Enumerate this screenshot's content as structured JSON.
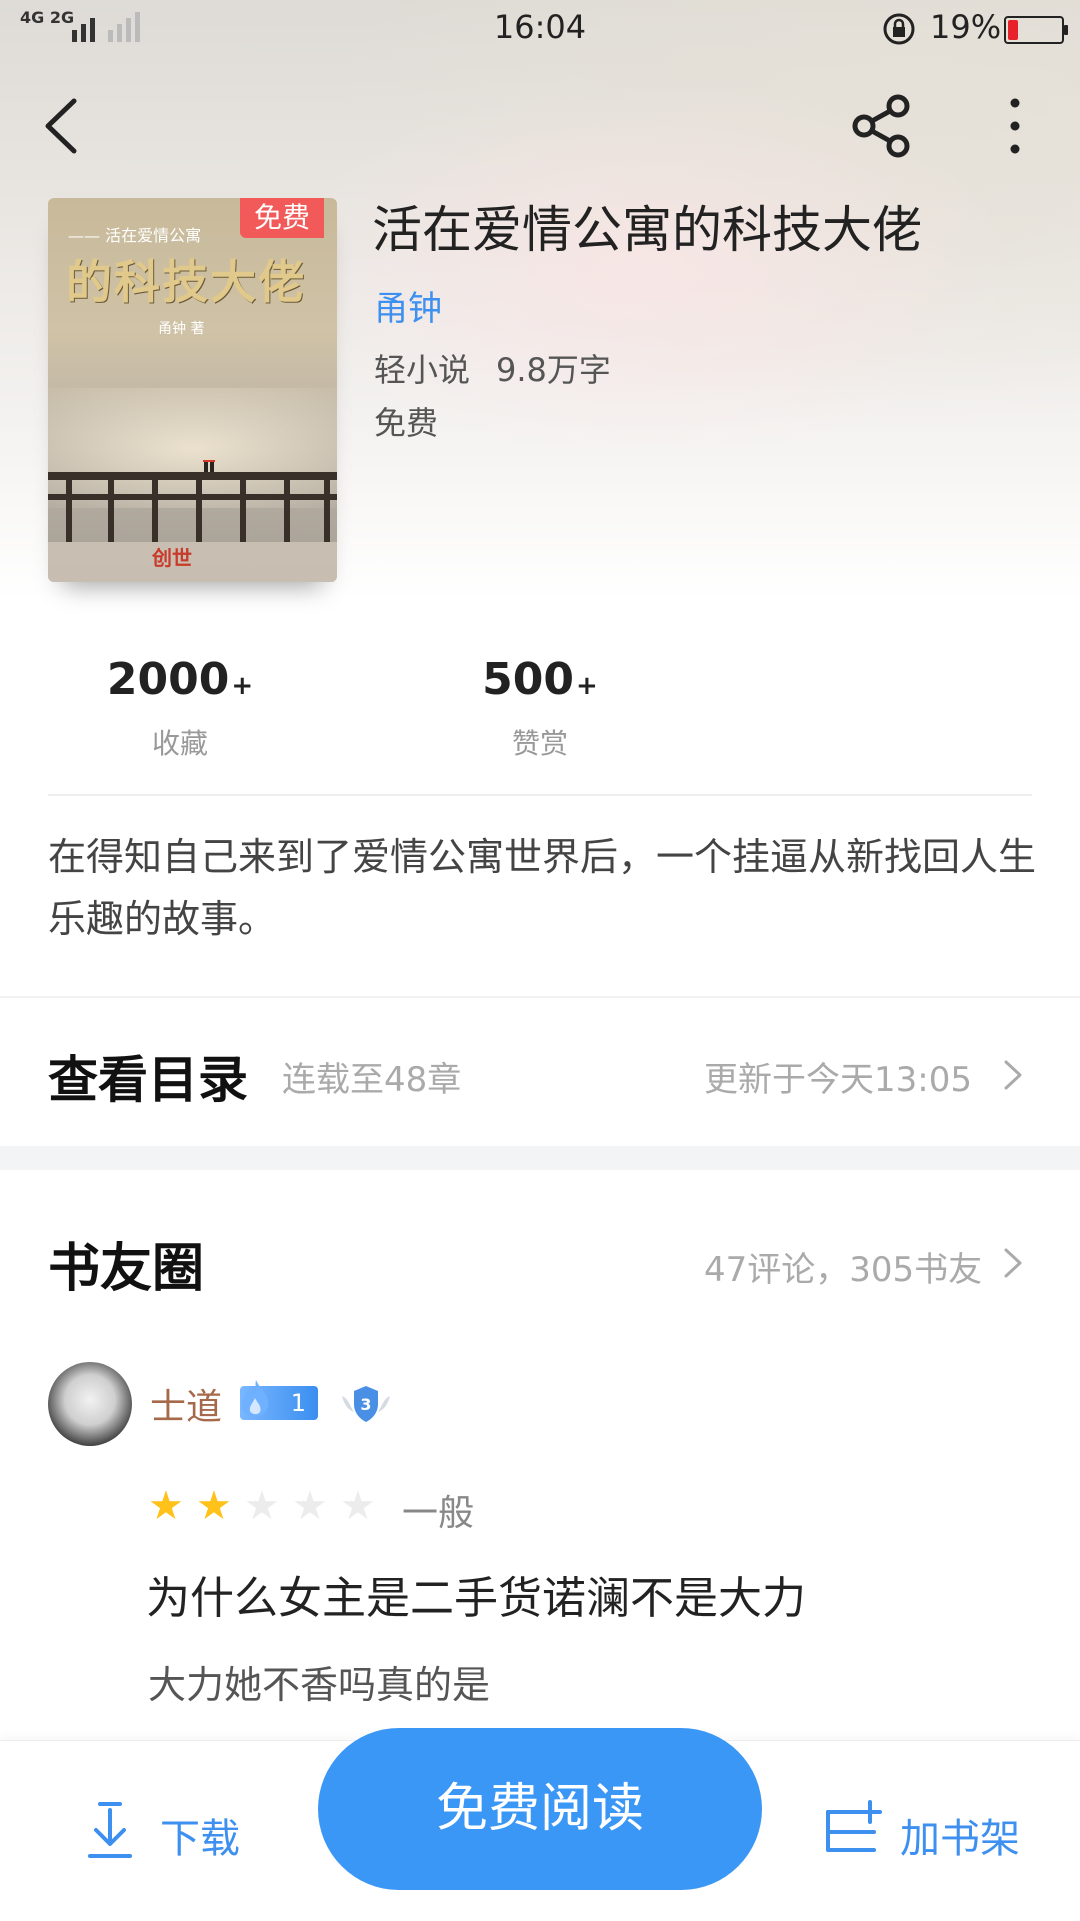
{
  "status_bar": {
    "time": "16:04",
    "network": "4G 2G",
    "battery": "19%"
  },
  "book": {
    "title": "活在爱情公寓的科技大佬",
    "author": "甬钟",
    "category": "轻小说",
    "word_count": "9.8万字",
    "price": "免费",
    "badge": "免费",
    "cover": {
      "subtitle": "—— 活在爱情公寓",
      "title": "的科技大佬",
      "author": "甬钟 著",
      "publisher": "创世"
    }
  },
  "stats": [
    {
      "value": "2000",
      "suffix": "+",
      "label": "收藏"
    },
    {
      "value": "500",
      "suffix": "+",
      "label": "赞赏"
    }
  ],
  "description": "在得知自己来到了爱情公寓世界后，一个挂逼从新找回人生乐趣的故事。",
  "catalog": {
    "title": "查看目录",
    "status": "连载至48章",
    "update": "更新于今天13:05"
  },
  "circle": {
    "title": "书友圈",
    "count": "47评论，305书友"
  },
  "review": {
    "username": "士道",
    "fan_level": "1",
    "shield_level": "3",
    "stars": 2,
    "max_stars": 5,
    "rating_label": "一般",
    "title": "为什么女主是二手货诺澜不是大力",
    "body": "大力她不香吗真的是"
  },
  "bottom_bar": {
    "download": "下载",
    "read": "免费阅读",
    "add_shelf": "加书架"
  },
  "colors": {
    "accent": "#3b97f5",
    "link": "#3d8ff0",
    "badge": "#f25a5a",
    "star": "#ffc21a",
    "username": "#a6694a"
  }
}
